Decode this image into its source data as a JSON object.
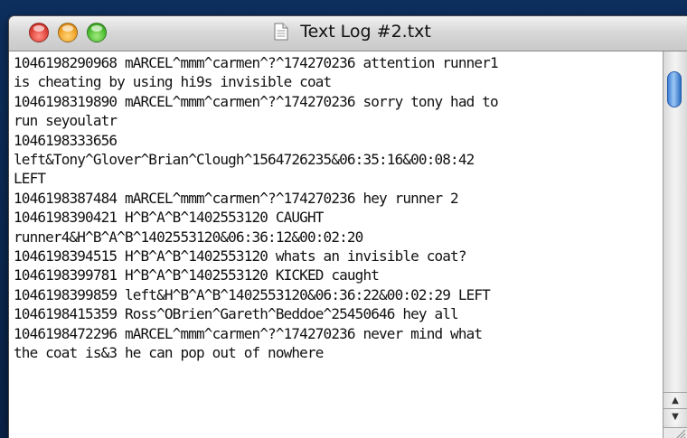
{
  "window": {
    "title": "Text Log #2.txt"
  },
  "controls": {
    "close_color": "#e0443a",
    "minimize_color": "#f0a429",
    "zoom_color": "#4fbf34"
  },
  "icons": {
    "document": "text-document-icon",
    "scroll_up": "arrow-up-icon",
    "scroll_down": "arrow-down-icon"
  },
  "log_lines": [
    "1046198290968 mARCEL^mmm^carmen^?^174270236 attention runner1",
    "is cheating by using hi9s invisible coat",
    "1046198319890 mARCEL^mmm^carmen^?^174270236 sorry tony had to",
    "run seyoulatr",
    "1046198333656",
    "left&Tony^Glover^Brian^Clough^1564726235&06:35:16&00:08:42",
    "LEFT",
    "1046198387484 mARCEL^mmm^carmen^?^174270236 hey runner 2",
    "1046198390421 H^B^A^B^1402553120 CAUGHT",
    "runner4&H^B^A^B^1402553120&06:36:12&00:02:20",
    "1046198394515 H^B^A^B^1402553120 whats an invisible coat?",
    "1046198399781 H^B^A^B^1402553120 KICKED caught",
    "1046198399859 left&H^B^A^B^1402553120&06:36:22&00:02:29 LEFT",
    "1046198415359 Ross^OBrien^Gareth^Beddoe^25450646 hey all",
    "1046198472296 mARCEL^mmm^carmen^?^174270236 never mind what",
    "the coat is&3 he can pop out of nowhere"
  ]
}
